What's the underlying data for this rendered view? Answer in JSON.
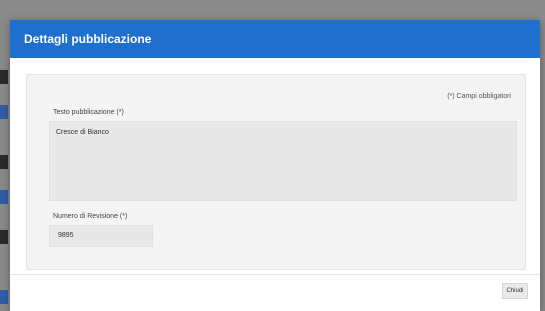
{
  "dialog": {
    "title": "Dettagli pubblicazione",
    "required_note": "(*) Campi obbligatori",
    "testo_label": "Testo pubblicazione (*)",
    "testo_value": "Cresce di Bianco",
    "numero_label": "Numero di Revisione (*)",
    "numero_value": "9895",
    "close_label": "Chiudi"
  },
  "colors": {
    "header": "#1f6fce",
    "body_panel": "#f4f4f4",
    "field_bg": "#e8e8e8"
  }
}
